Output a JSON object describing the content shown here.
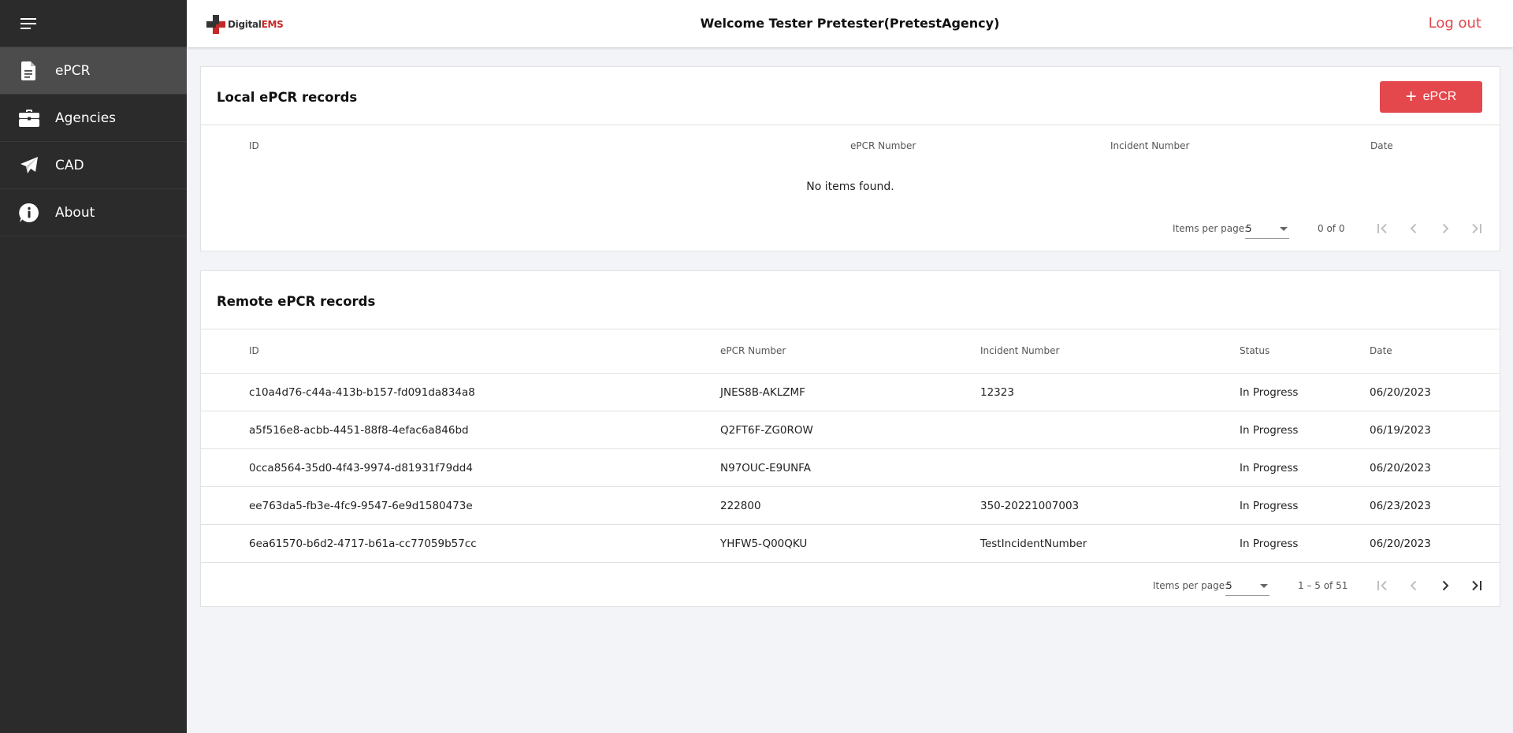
{
  "sidebar": {
    "items": [
      {
        "label": "ePCR",
        "icon": "document-icon"
      },
      {
        "label": "Agencies",
        "icon": "briefcase-icon"
      },
      {
        "label": "CAD",
        "icon": "paper-plane-icon"
      },
      {
        "label": "About",
        "icon": "info-icon"
      }
    ]
  },
  "header": {
    "logo": {
      "digital": "Digital",
      "ems": "EMS"
    },
    "welcome": "Welcome Tester Pretester(PretestAgency)",
    "logout": "Log out"
  },
  "local": {
    "title": "Local ePCR records",
    "add_button": "ePCR",
    "columns": [
      "ID",
      "ePCR Number",
      "Incident Number",
      "Date"
    ],
    "empty_text": "No items found.",
    "paginator": {
      "items_per_page_label": "Items per page:",
      "page_size": "5",
      "range": "0 of 0"
    }
  },
  "remote": {
    "title": "Remote ePCR records",
    "columns": [
      "ID",
      "ePCR Number",
      "Incident Number",
      "Status",
      "Date"
    ],
    "rows": [
      {
        "id": "c10a4d76-c44a-413b-b157-fd091da834a8",
        "epcr": "JNES8B-AKLZMF",
        "incident": "12323",
        "status": "In Progress",
        "date": "06/20/2023"
      },
      {
        "id": "a5f516e8-acbb-4451-88f8-4efac6a846bd",
        "epcr": "Q2FT6F-ZG0ROW",
        "incident": "",
        "status": "In Progress",
        "date": "06/19/2023"
      },
      {
        "id": "0cca8564-35d0-4f43-9974-d81931f79dd4",
        "epcr": "N97OUC-E9UNFA",
        "incident": "",
        "status": "In Progress",
        "date": "06/20/2023"
      },
      {
        "id": "ee763da5-fb3e-4fc9-9547-6e9d1580473e",
        "epcr": "222800",
        "incident": "350-20221007003",
        "status": "In Progress",
        "date": "06/23/2023"
      },
      {
        "id": "6ea61570-b6d2-4717-b61a-cc77059b57cc",
        "epcr": "YHFW5-Q00QKU",
        "incident": "TestIncidentNumber",
        "status": "In Progress",
        "date": "06/20/2023"
      }
    ],
    "paginator": {
      "items_per_page_label": "Items per page:",
      "page_size": "5",
      "range": "1 – 5 of 51"
    }
  },
  "colors": {
    "sidebar_bg": "#2b2b2b",
    "sidebar_active": "#4c4c4c",
    "accent": "#e4474c",
    "page_bg": "#f3f4f8"
  }
}
